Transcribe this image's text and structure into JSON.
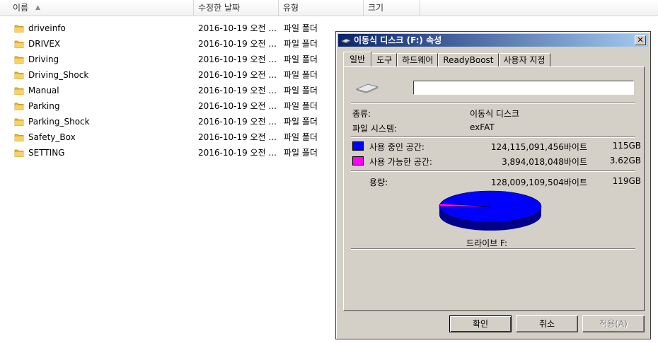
{
  "columns": {
    "name": "이름",
    "date": "수정한 날짜",
    "type": "유형",
    "size": "크기"
  },
  "files": [
    {
      "name": "driveinfo",
      "date": "2016-10-19 오전 ...",
      "type": "파일 폴더"
    },
    {
      "name": "DRIVEX",
      "date": "2016-10-19 오전 ...",
      "type": "파일 폴더"
    },
    {
      "name": "Driving",
      "date": "2016-10-19 오전 ...",
      "type": "파일 폴더"
    },
    {
      "name": "Driving_Shock",
      "date": "2016-10-19 오전 ...",
      "type": "파일 폴더"
    },
    {
      "name": "Manual",
      "date": "2016-10-19 오전 ...",
      "type": "파일 폴더"
    },
    {
      "name": "Parking",
      "date": "2016-10-19 오전 ...",
      "type": "파일 폴더"
    },
    {
      "name": "Parking_Shock",
      "date": "2016-10-19 오전 ...",
      "type": "파일 폴더"
    },
    {
      "name": "Safety_Box",
      "date": "2016-10-19 오전 ...",
      "type": "파일 폴더"
    },
    {
      "name": "SETTING",
      "date": "2016-10-19 오전 ...",
      "type": "파일 폴더"
    }
  ],
  "dialog": {
    "title": "이동식 디스크 (F:) 속성",
    "close": "✕",
    "tabs": [
      "일반",
      "도구",
      "하드웨어",
      "ReadyBoost",
      "사용자 지정"
    ],
    "label_value": "",
    "type_label": "종류:",
    "type_value": "이동식 디스크",
    "fs_label": "파일 시스템:",
    "fs_value": "exFAT",
    "used_label": "사용 중인 공간:",
    "used_bytes": "124,115,091,456바이트",
    "used_gb": "115GB",
    "free_label": "사용 가능한 공간:",
    "free_bytes": "3,894,018,048바이트",
    "free_gb": "3.62GB",
    "cap_label": "용량:",
    "cap_bytes": "128,009,109,504바이트",
    "cap_gb": "119GB",
    "drive_caption": "드라이브 F:",
    "used_color": "#0000ff",
    "free_color": "#ff00ff",
    "used_fraction": 0.9696,
    "buttons": {
      "ok": "확인",
      "cancel": "취소",
      "apply": "적용(A)"
    }
  }
}
